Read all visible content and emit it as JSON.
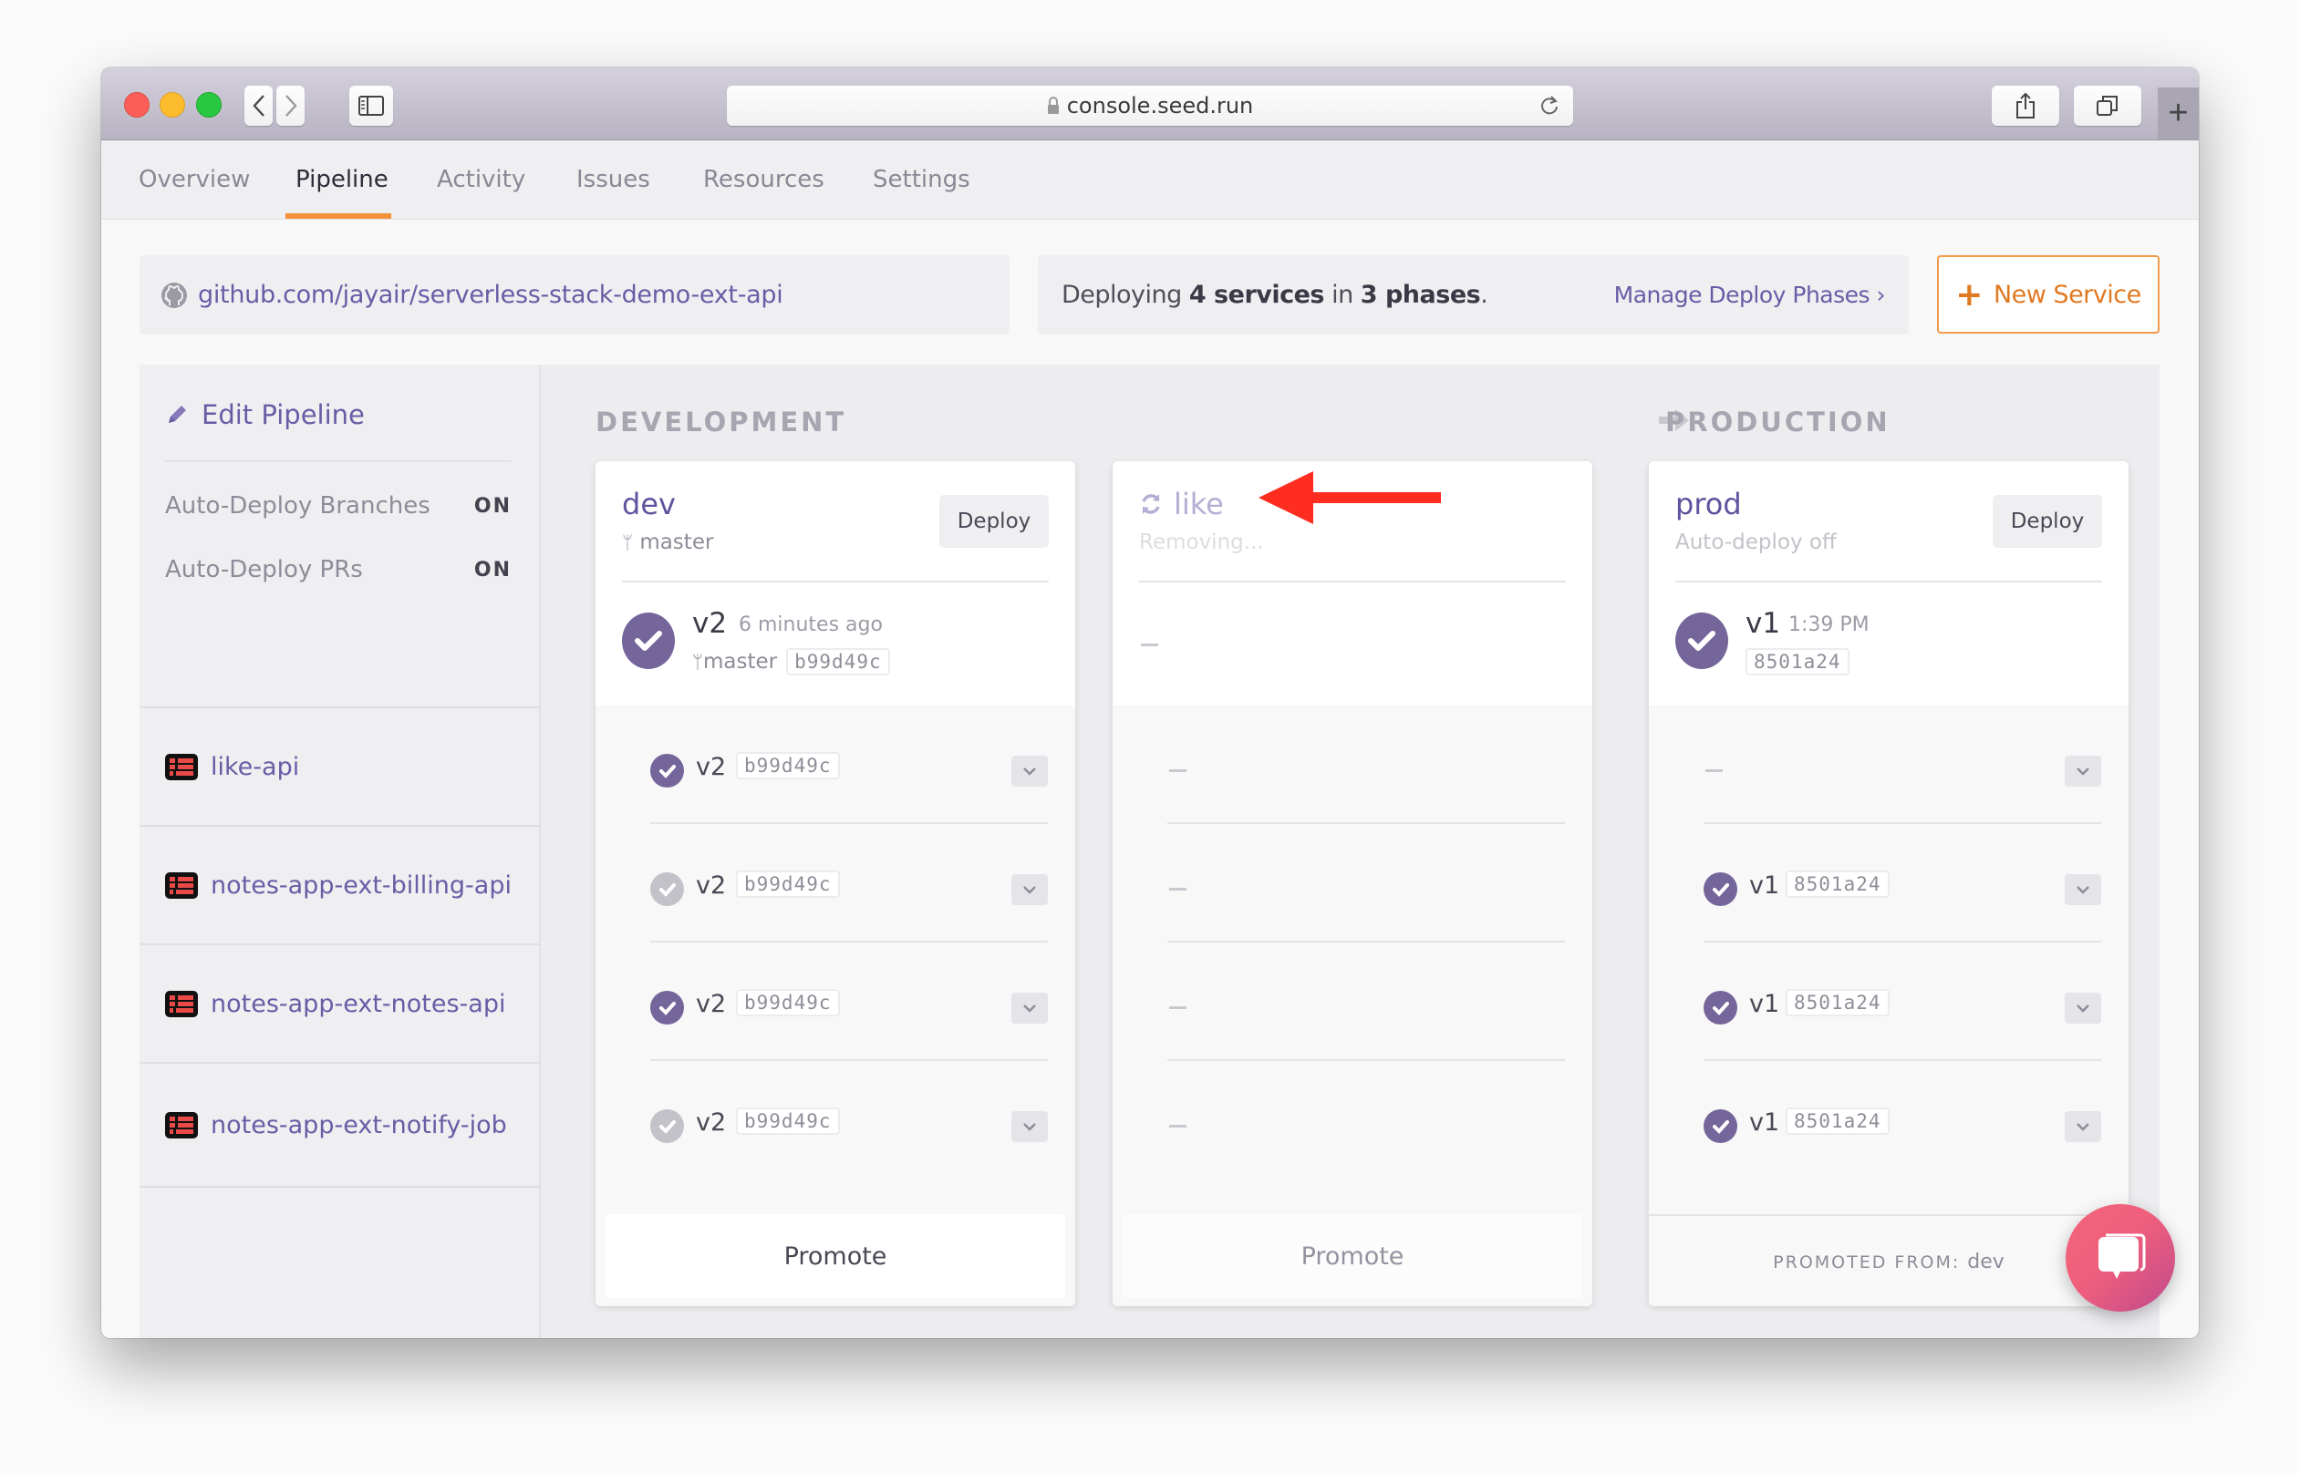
{
  "browser": {
    "url": "console.seed.run",
    "back_label": "Back",
    "forward_label": "Forward"
  },
  "nav": {
    "tabs": [
      {
        "label": "Overview",
        "active": false
      },
      {
        "label": "Pipeline",
        "active": true
      },
      {
        "label": "Activity",
        "active": false
      },
      {
        "label": "Issues",
        "active": false
      },
      {
        "label": "Resources",
        "active": false
      },
      {
        "label": "Settings",
        "active": false
      }
    ]
  },
  "repo": {
    "link": "github.com/jayair/serverless-stack-demo-ext-api"
  },
  "deploy_info": {
    "prefix": "Deploying ",
    "services": "4 services",
    "middle": " in ",
    "phases": "3 phases",
    "suffix": ".",
    "manage_link": "Manage Deploy Phases ›"
  },
  "new_service": {
    "label": "New Service"
  },
  "sidebar": {
    "edit_label": "Edit Pipeline",
    "settings": [
      {
        "label": "Auto-Deploy Branches",
        "value": "ON"
      },
      {
        "label": "Auto-Deploy PRs",
        "value": "ON"
      }
    ],
    "services": [
      {
        "name": "like-api"
      },
      {
        "name": "notes-app-ext-billing-api"
      },
      {
        "name": "notes-app-ext-notes-api"
      },
      {
        "name": "notes-app-ext-notify-job"
      }
    ]
  },
  "stages": {
    "development": "DEVELOPMENT",
    "production": "PRODUCTION"
  },
  "colors": {
    "accent": "#6a5ca5",
    "check_purple": "#74659a",
    "check_gray": "#c3c2c9",
    "orange": "#f5913a",
    "annotation_red": "#ff2d20"
  },
  "cards": {
    "dev": {
      "name": "dev",
      "branch": "master",
      "deploy_label": "Deploy",
      "latest": {
        "version": "v2",
        "time": "6 minutes ago",
        "branch": "master",
        "commit": "b99d49c"
      },
      "rows": [
        {
          "version": "v2",
          "commit": "b99d49c",
          "status": "success"
        },
        {
          "version": "v2",
          "commit": "b99d49c",
          "status": "skipped"
        },
        {
          "version": "v2",
          "commit": "b99d49c",
          "status": "success"
        },
        {
          "version": "v2",
          "commit": "b99d49c",
          "status": "skipped"
        }
      ],
      "promote_label": "Promote"
    },
    "like": {
      "name": "like",
      "status": "Removing...",
      "latest": "—",
      "rows": [
        "—",
        "—",
        "—",
        "—"
      ],
      "promote_label": "Promote"
    },
    "prod": {
      "name": "prod",
      "subtitle": "Auto-deploy off",
      "deploy_label": "Deploy",
      "latest": {
        "version": "v1",
        "time": "1:39 PM",
        "commit": "8501a24"
      },
      "rows": [
        {
          "version": "",
          "commit": "",
          "status": "none",
          "dash": "—"
        },
        {
          "version": "v1",
          "commit": "8501a24",
          "status": "success"
        },
        {
          "version": "v1",
          "commit": "8501a24",
          "status": "success"
        },
        {
          "version": "v1",
          "commit": "8501a24",
          "status": "success"
        }
      ],
      "promoted_label": "PROMOTED FROM:",
      "promoted_from": "dev"
    }
  }
}
